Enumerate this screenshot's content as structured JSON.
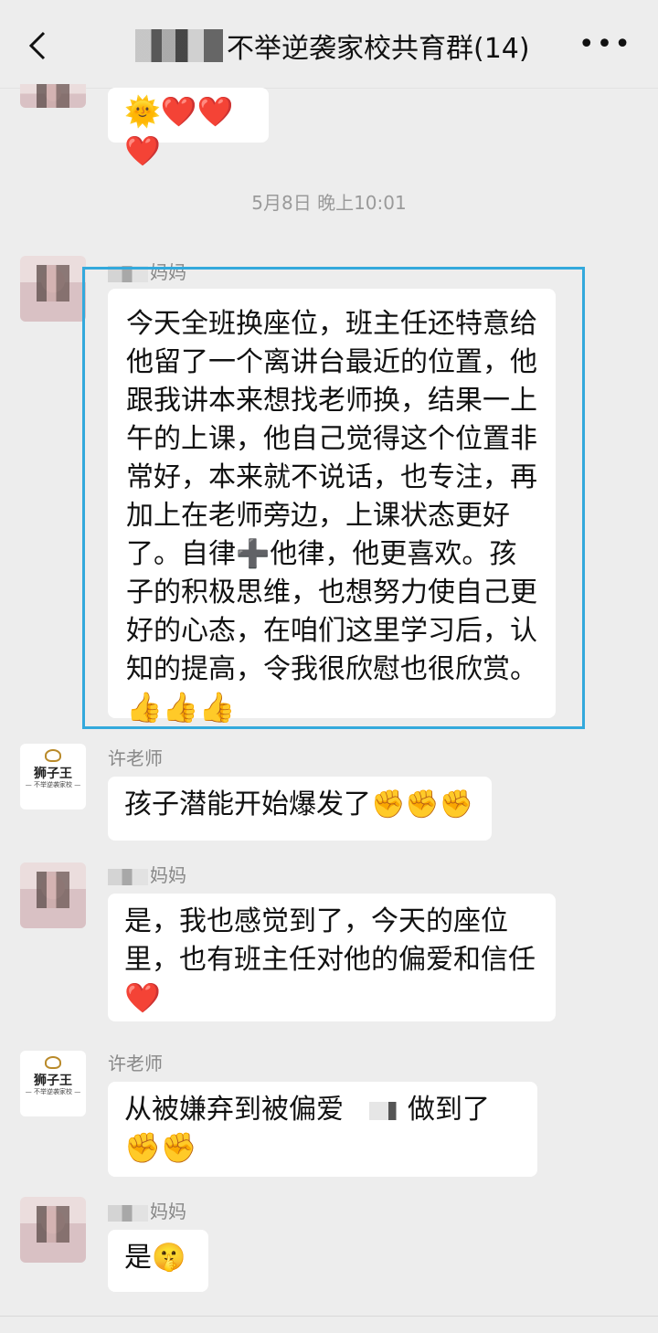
{
  "header": {
    "back_icon": "chevron-left-icon",
    "title": "不举逆袭家校共育群(14)",
    "more_icon": "more-dots-icon"
  },
  "messages": {
    "prev_reactions": "🌞❤️❤️❤️",
    "timestamp": "5月8日 晚上10:01",
    "m1": {
      "sender": "妈妈",
      "text": "今天全班换座位，班主任还特意给他留了一个离讲台最近的位置，他跟我讲本来想找老师换，结果一上午的上课，他自己觉得这个位置非常好，本来就不说话，也专注，再加上在老师旁边，上课状态更好了。自律➕他律，他更喜欢。孩子的积极思维，也想努力使自己更好的心态，在咱们这里学习后，认知的提高，令我很欣慰也很欣赏。",
      "emoji": "👍👍👍"
    },
    "m2": {
      "sender": "许老师",
      "text": "孩子潜能开始爆发了✊✊✊"
    },
    "m3": {
      "sender": "妈妈",
      "text": "是，我也感觉到了，今天的座位里，也有班主任对他的偏爱和信任",
      "emoji": "❤️"
    },
    "m4": {
      "sender": "许老师",
      "text_a": "从被嫌弃到被偏爱",
      "text_b": "做到了",
      "emoji": "✊✊"
    },
    "m5": {
      "sender": "妈妈",
      "text": "是🤫"
    }
  },
  "logo": {
    "brand": "狮子王",
    "sub": "— 不举逆袭家校 —"
  },
  "colors": {
    "highlight_border": "#33a9dc",
    "background": "#ededed",
    "bubble": "#ffffff"
  }
}
